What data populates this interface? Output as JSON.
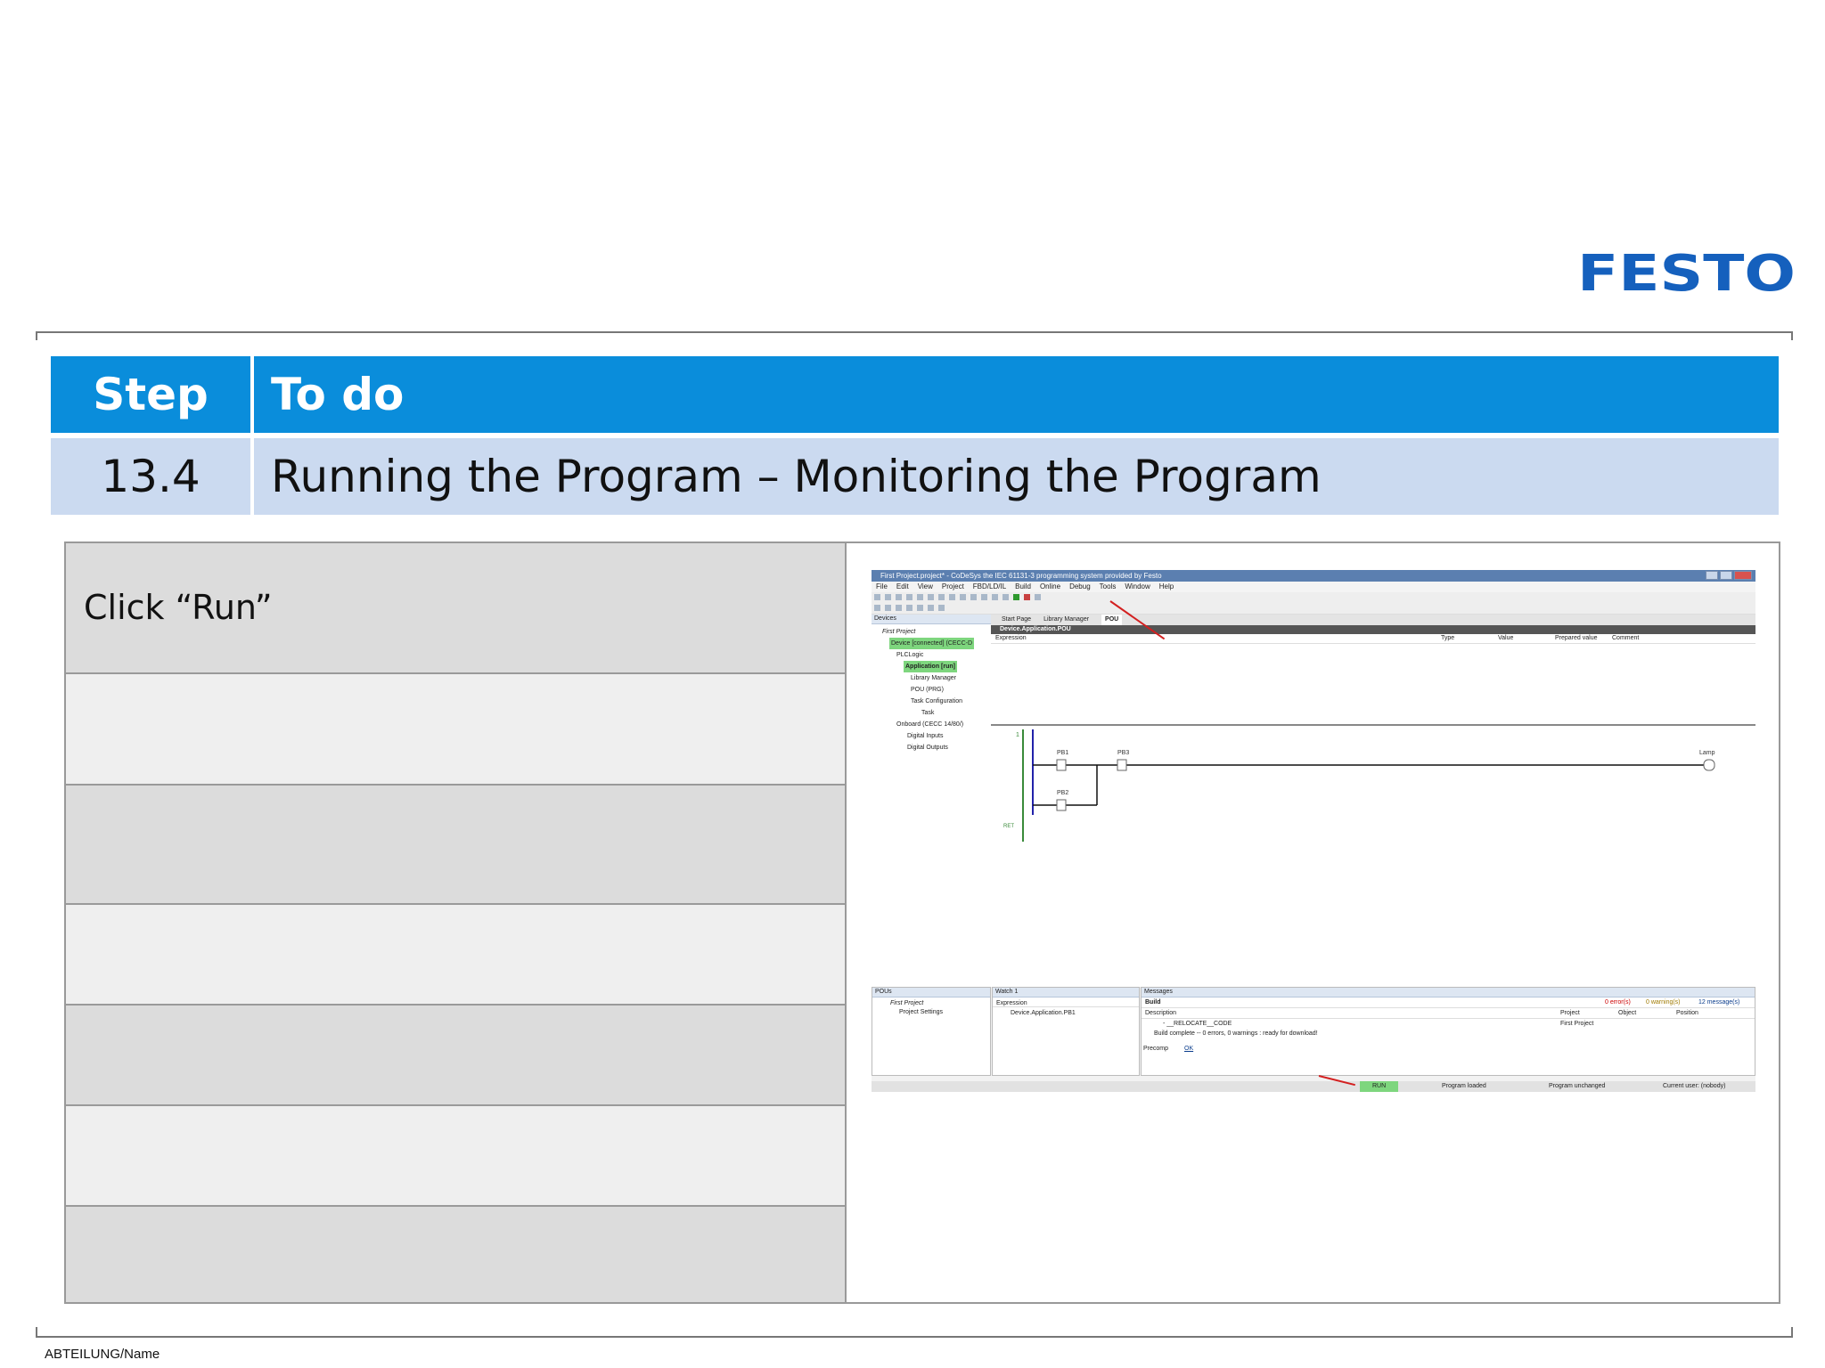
{
  "brand": {
    "logo_text": "FESTO",
    "color": "#1560bd"
  },
  "header": {
    "col1": "Step",
    "col2": "To do",
    "bg": "#0a8ddb"
  },
  "subheader": {
    "step": "13.4",
    "title": "Running the Program – Monitoring the Program",
    "bg": "#cbdaf0"
  },
  "instructions": [
    "Click “Run”",
    "",
    "",
    "",
    "",
    "",
    ""
  ],
  "footer": {
    "text": "ABTEILUNG/Name"
  },
  "screenshot": {
    "window_title": "First Project.project* - CoDeSys the IEC 61131-3 programming system provided by Festo",
    "menu": [
      "File",
      "Edit",
      "View",
      "Project",
      "FBD/LD/IL",
      "Build",
      "Online",
      "Debug",
      "Tools",
      "Window",
      "Help"
    ],
    "devices_panel": "Devices",
    "tree": [
      "First Project",
      "Device [connected] (CECC-D",
      "PLCLogic",
      "Application [run]",
      "Library Manager",
      "POU (PRG)",
      "Task Configuration",
      "Task",
      "Onboard (CECC 14/80/)",
      "Digital Inputs",
      "Digital Outputs"
    ],
    "tabs": [
      "Start Page",
      "Library Manager",
      "POU"
    ],
    "pou_title": "Device.Application.POU",
    "watch_columns": [
      "Expression",
      "Type",
      "Value",
      "Prepared value",
      "Comment"
    ],
    "ladder": {
      "contact1": "PB1",
      "contact2": "PB3",
      "contact3": "PB2",
      "coil": "Lamp",
      "rung": "1",
      "ret": "RET"
    },
    "pous_panel": "POUs",
    "pous_tree": [
      "First Project",
      "Project Settings"
    ],
    "watch_panel": "Watch 1",
    "watch_expression": "Expression",
    "watch_item": "Device.Application.PB1",
    "messages_panel": "Messages",
    "messages_filter": "Build",
    "messages_counts": [
      "0 error(s)",
      "0 warning(s)",
      "12 message(s)"
    ],
    "messages_columns": [
      "Description",
      "Project",
      "Object",
      "Position"
    ],
    "messages_rows": [
      "- __RELOCATE__CODE",
      "Build complete -- 0 errors, 0 warnings : ready for download!"
    ],
    "messages_project": "First Project",
    "precomp_label": "Precomp",
    "precomp_status": "OK",
    "status": {
      "run": "RUN",
      "loaded": "Program loaded",
      "unchanged": "Program unchanged",
      "user": "Current user: (nobody)"
    }
  }
}
